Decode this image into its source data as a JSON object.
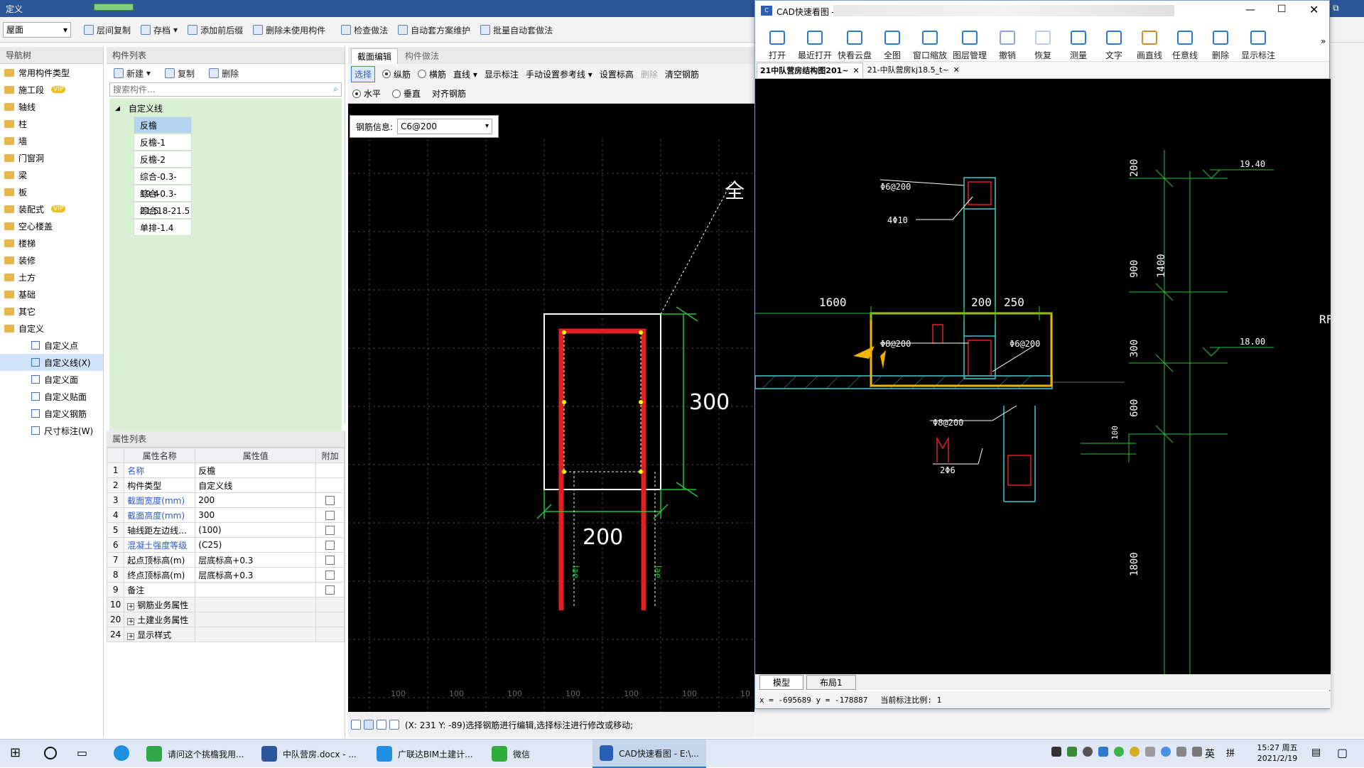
{
  "main_title": "定义",
  "toolbar": {
    "floor": "屋面",
    "items": [
      "层间复制",
      "存档",
      "添加前后缀",
      "删除未使用构件",
      "检查做法",
      "自动套方案维护",
      "批量自动套做法"
    ]
  },
  "nav": {
    "header": "导航树",
    "items": [
      "常用构件类型",
      "施工段",
      "轴线",
      "柱",
      "墙",
      "门窗洞",
      "梁",
      "板",
      "装配式",
      "空心楼盖",
      "楼梯",
      "装修",
      "土方",
      "基础",
      "其它",
      "自定义"
    ],
    "vip_label": "VIP",
    "sub_items": [
      "自定义点",
      "自定义线(X)",
      "自定义面",
      "自定义贴面",
      "自定义钢筋",
      "尺寸标注(W)"
    ]
  },
  "components": {
    "header": "构件列表",
    "new": "新建",
    "copy": "复制",
    "delete": "删除",
    "search_placeholder": "搜索构件...",
    "group": "自定义线",
    "items": [
      "反檐",
      "反檐-1",
      "反檐-2",
      "综合-0.3-19.4",
      "综合-0.3-21.5",
      "综合18-21.5",
      "单排-1.4"
    ]
  },
  "props": {
    "header": "属性列表",
    "col_name": "属性名称",
    "col_value": "属性值",
    "col_extra": "附加",
    "rows": [
      {
        "no": "1",
        "name": "名称",
        "value": "反檐",
        "blue": true,
        "check": false
      },
      {
        "no": "2",
        "name": "构件类型",
        "value": "自定义线",
        "blue": false,
        "check": false
      },
      {
        "no": "3",
        "name": "截面宽度(mm)",
        "value": "200",
        "blue": true,
        "check": true
      },
      {
        "no": "4",
        "name": "截面高度(mm)",
        "value": "300",
        "blue": true,
        "check": true
      },
      {
        "no": "5",
        "name": "轴线距左边线...",
        "value": "(100)",
        "blue": false,
        "check": true
      },
      {
        "no": "6",
        "name": "混凝土强度等级",
        "value": "(C25)",
        "blue": true,
        "check": true
      },
      {
        "no": "7",
        "name": "起点顶标高(m)",
        "value": "层底标高+0.3",
        "blue": false,
        "check": true
      },
      {
        "no": "8",
        "name": "终点顶标高(m)",
        "value": "层底标高+0.3",
        "blue": false,
        "check": true
      },
      {
        "no": "9",
        "name": "备注",
        "value": "",
        "blue": false,
        "check": true
      },
      {
        "no": "10",
        "name": "钢筋业务属性",
        "value": "",
        "blue": false,
        "check": false
      },
      {
        "no": "20",
        "name": "土建业务属性",
        "value": "",
        "blue": false,
        "check": false
      },
      {
        "no": "24",
        "name": "显示样式",
        "value": "",
        "blue": false,
        "check": false
      }
    ]
  },
  "editor": {
    "tabs": [
      "截面编辑",
      "构件做法"
    ],
    "mode_select": "选择",
    "radio_long": "纵筋",
    "radio_hoop": "横筋",
    "line": "直线",
    "show_dim": "显示标注",
    "manual_ref": "手动设置参考线",
    "set_elev": "设置标高",
    "del": "删除",
    "clear": "清空钢筋",
    "horizontal": "水平",
    "vertical": "垂直",
    "align": "对齐钢筋",
    "rebar_label": "钢筋信息:",
    "rebar_value": "C6@200",
    "dim_300": "300",
    "dim_200": "200",
    "lae": "lae",
    "quan": "全",
    "ruler": [
      "100",
      "100",
      "100",
      "100",
      "100",
      "100",
      "10"
    ],
    "status": "(X: 231 Y: -89)选择钢筋进行编辑,选择标注进行修改或移动;"
  },
  "cad": {
    "title": "CAD快速看图 -",
    "ribbon": [
      "打开",
      "最近打开",
      "快看云盘",
      "全图",
      "窗口缩放",
      "图层管理",
      "撤销",
      "恢复",
      "测量",
      "文字",
      "画直线",
      "任意线",
      "删除",
      "显示标注"
    ],
    "doc_tabs": [
      "21中队营房结构图201~",
      "21-中队营房kj18.5_t~"
    ],
    "layout_tabs": [
      "模型",
      "布局1"
    ],
    "coord": "x = -695689 y = -178887",
    "scale": "当前标注比例: 1",
    "labels": {
      "a": "Φ6@200",
      "b": "4Φ10",
      "c": "1600",
      "d": "200",
      "e": "250",
      "f": "Φ8@200",
      "g": "Φ6@200",
      "h": "Φ8@200",
      "i": "2Φ6",
      "j": "100",
      "v1": "200",
      "v2": "900",
      "v3": "300",
      "v4": "600",
      "v5": "1800",
      "v6": "1400",
      "e1": "19.40",
      "e2": "18.00",
      "rf": "RF"
    }
  },
  "taskbar": {
    "apps": [
      "请问这个挑檐我用...",
      "中队营房.docx - ...",
      "广联达BIM土建计...",
      "微信",
      "CAD快速看图 - E:\\..."
    ],
    "ime": "英",
    "ime2": "拼",
    "time": "15:27 周五",
    "date": "2021/2/19"
  }
}
